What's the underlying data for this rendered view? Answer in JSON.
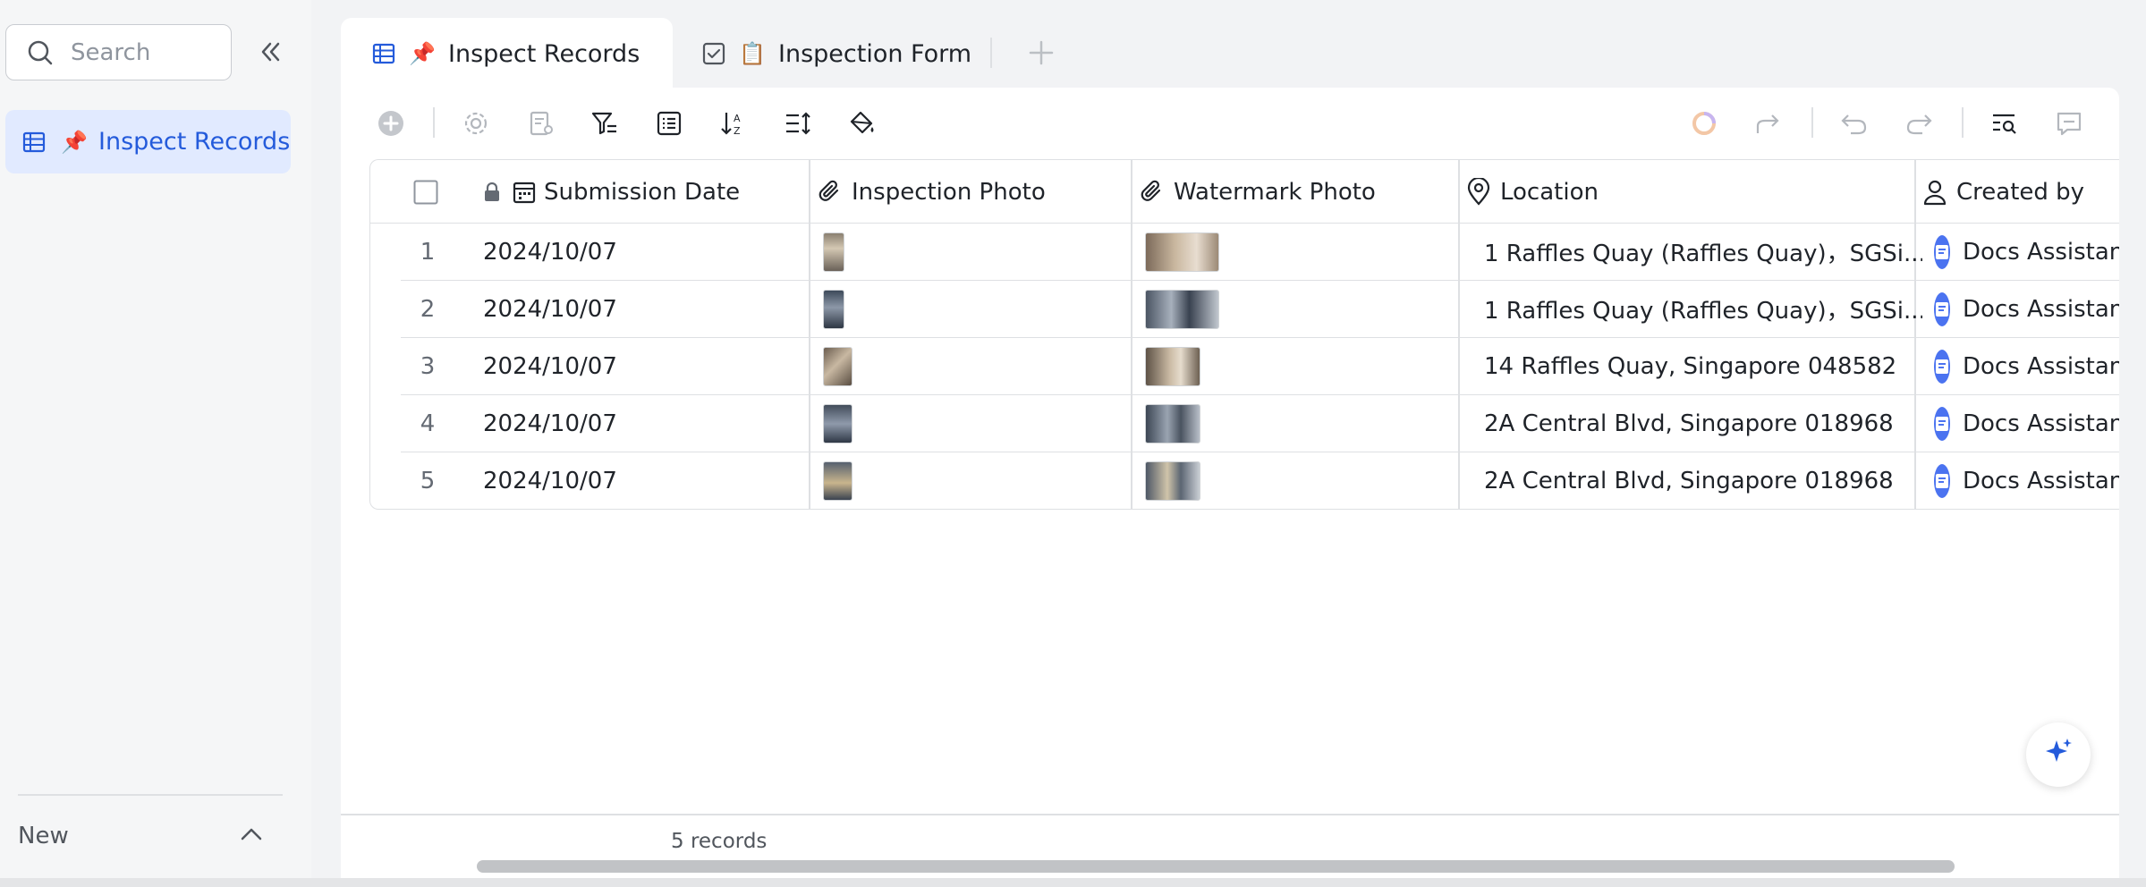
{
  "sidebar": {
    "search_placeholder": "Search",
    "items": [
      {
        "label": "Inspect Records",
        "emoji": "📌"
      }
    ],
    "new_label": "New"
  },
  "tabs": [
    {
      "label": "Inspect Records",
      "emoji": "📌",
      "active": true
    },
    {
      "label": "Inspection Form",
      "emoji": "📋",
      "active": false
    }
  ],
  "table": {
    "columns": [
      {
        "label": "Submission Date",
        "icon": "calendar-icon",
        "locked": true
      },
      {
        "label": "Inspection Photo",
        "icon": "attachment-icon"
      },
      {
        "label": "Watermark Photo",
        "icon": "attachment-icon"
      },
      {
        "label": "Location",
        "icon": "location-icon"
      },
      {
        "label": "Created by",
        "icon": "person-icon"
      }
    ],
    "rows": [
      {
        "num": "1",
        "date": "2024/10/07",
        "location": "1 Raffles Quay (Raffles Quay)，SGSi...",
        "creator": "Docs Assistant"
      },
      {
        "num": "2",
        "date": "2024/10/07",
        "location": "1 Raffles Quay (Raffles Quay)，SGSi...",
        "creator": "Docs Assistant"
      },
      {
        "num": "3",
        "date": "2024/10/07",
        "location": "14 Raffles Quay, Singapore 048582",
        "creator": "Docs Assistant"
      },
      {
        "num": "4",
        "date": "2024/10/07",
        "location": "2A Central Blvd, Singapore 018968",
        "creator": "Docs Assistant"
      },
      {
        "num": "5",
        "date": "2024/10/07",
        "location": "2A Central Blvd, Singapore 018968",
        "creator": "Docs Assistant"
      }
    ]
  },
  "footer": {
    "record_count": "5 records"
  },
  "colors": {
    "accent": "#245bdb",
    "active_bg": "#e1eaff",
    "border": "#dee0e3"
  }
}
